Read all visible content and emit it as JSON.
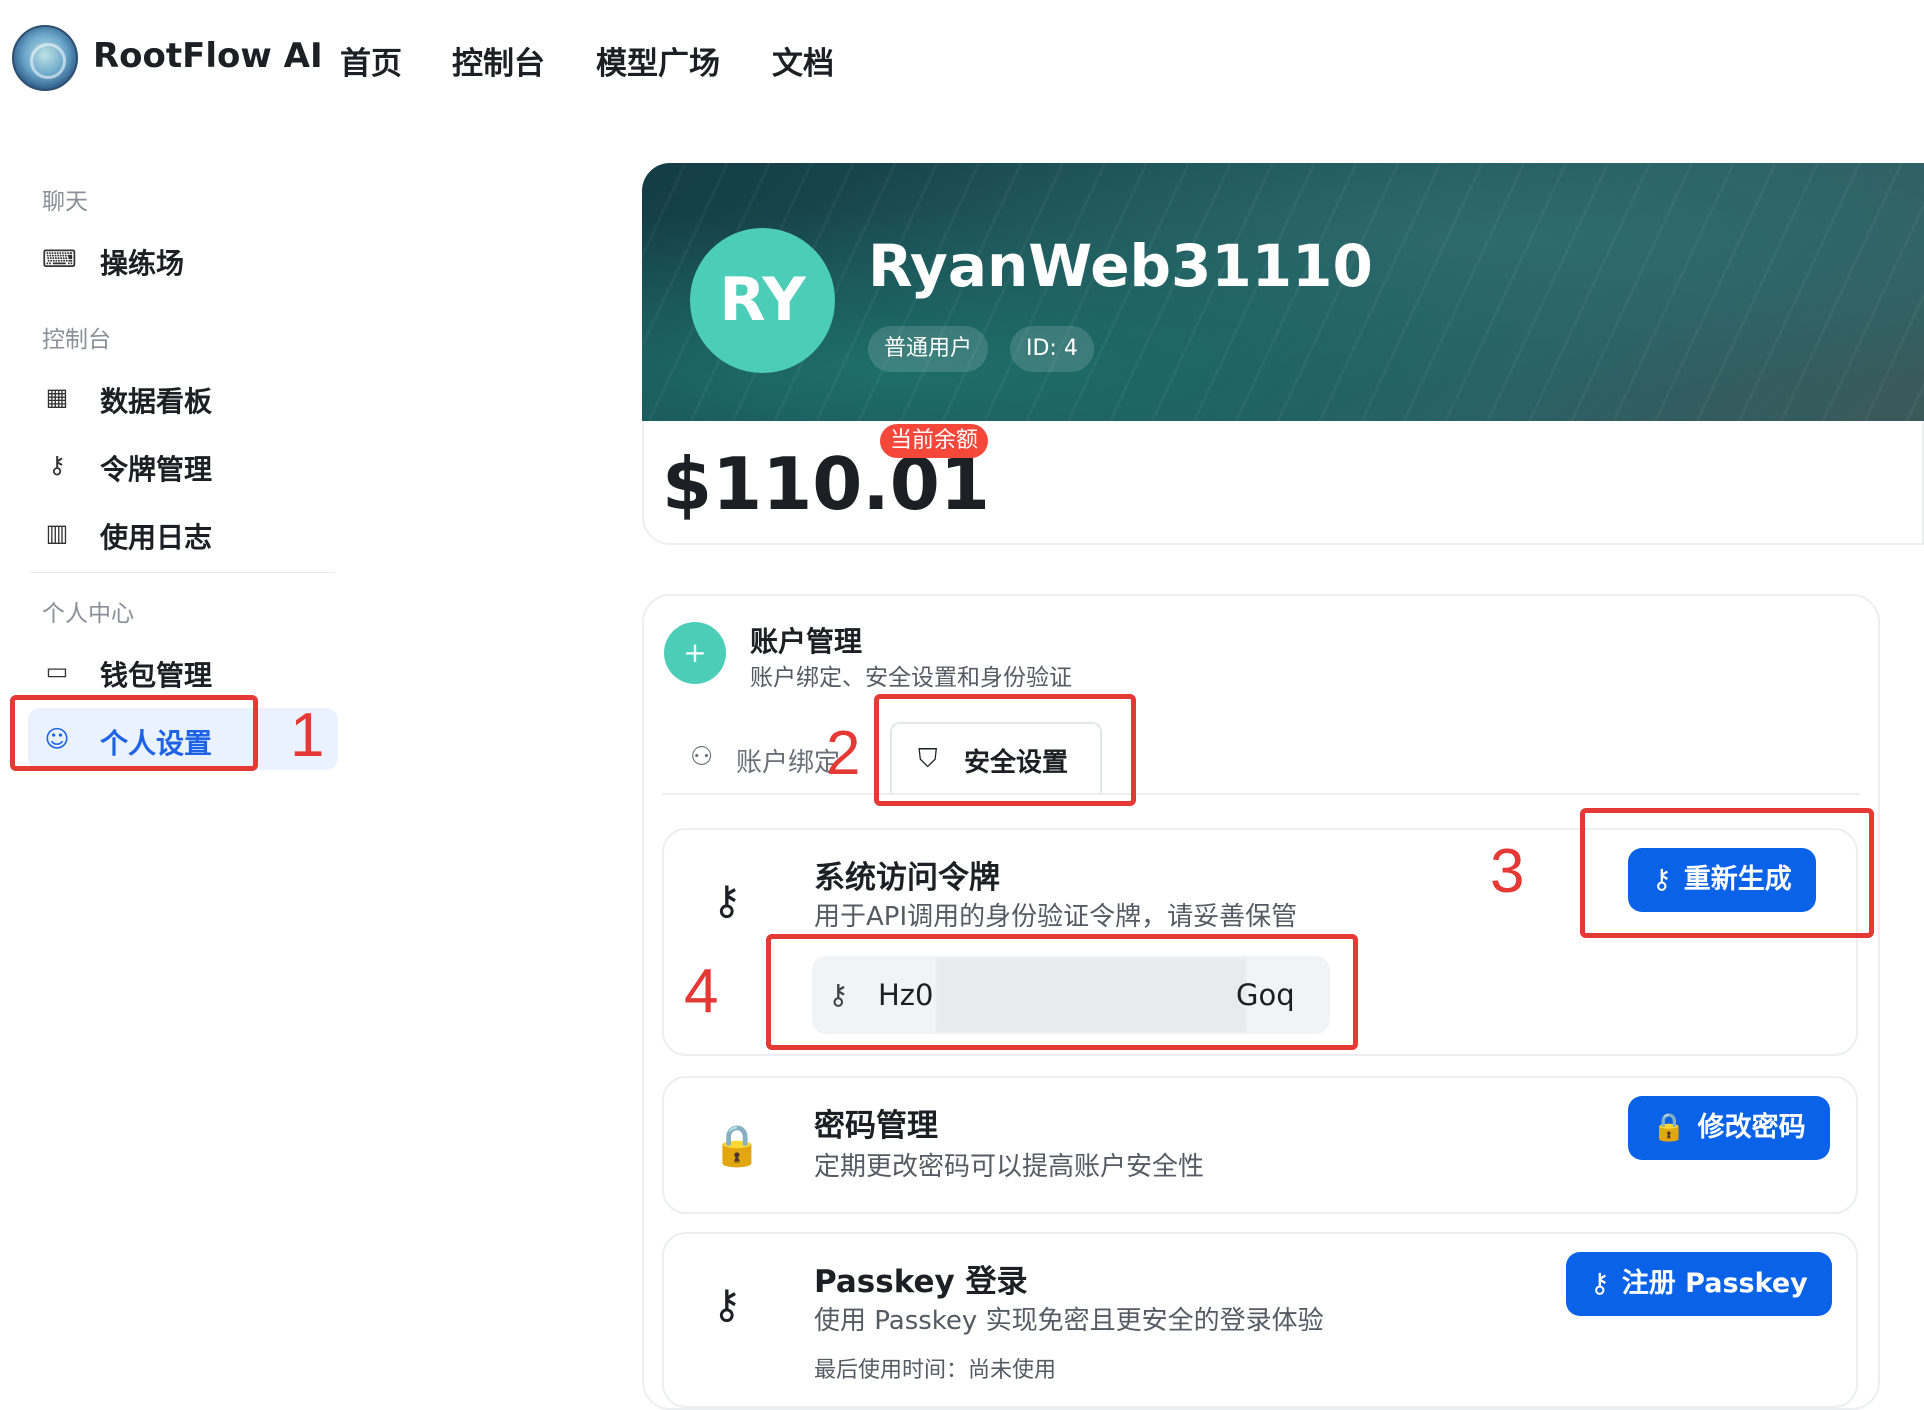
{
  "header": {
    "brand": "RootFlow AI",
    "nav": [
      "首页",
      "控制台",
      "模型广场",
      "文档"
    ]
  },
  "sidebar": {
    "groups": {
      "chat": "聊天",
      "console": "控制台",
      "personal": "个人中心"
    },
    "items": [
      {
        "label": "操练场",
        "icon": "terminal-icon"
      },
      {
        "label": "数据看板",
        "icon": "dashboard-grid-icon"
      },
      {
        "label": "令牌管理",
        "icon": "key-icon"
      },
      {
        "label": "使用日志",
        "icon": "bar-chart-icon"
      },
      {
        "label": "钱包管理",
        "icon": "wallet-icon"
      },
      {
        "label": "个人设置",
        "icon": "user-icon",
        "active": true
      }
    ]
  },
  "profile": {
    "avatar_initials": "RY",
    "username": "RyanWeb31110",
    "role": "普通用户",
    "id_label": "ID: 4",
    "balance_badge": "当前余额",
    "balance": "$110.01"
  },
  "account": {
    "title": "账户管理",
    "subtitle": "账户绑定、安全设置和身份验证",
    "tabs": [
      {
        "label": "账户绑定",
        "icon": "user-plus-icon"
      },
      {
        "label": "安全设置",
        "icon": "shield-icon",
        "active": true
      }
    ],
    "token": {
      "title": "系统访问令牌",
      "subtitle": "用于API调用的身份验证令牌，请妥善保管",
      "button": "重新生成",
      "value_start": "Hz0",
      "value_end": "Goq"
    },
    "password": {
      "title": "密码管理",
      "subtitle": "定期更改密码可以提高账户安全性",
      "button": "修改密码"
    },
    "passkey": {
      "title": "Passkey 登录",
      "subtitle": "使用 Passkey 实现免密且更安全的登录体验",
      "last_used": "最后使用时间：尚未使用",
      "button": "注册 Passkey"
    }
  },
  "annotations": [
    "1",
    "2",
    "3",
    "4"
  ],
  "colors": {
    "primary": "#0a62e8",
    "accent_teal": "#4ccdb8",
    "annotation_red": "#e53935",
    "badge_red": "#f5483b",
    "active_bg": "#eaf2ff"
  }
}
